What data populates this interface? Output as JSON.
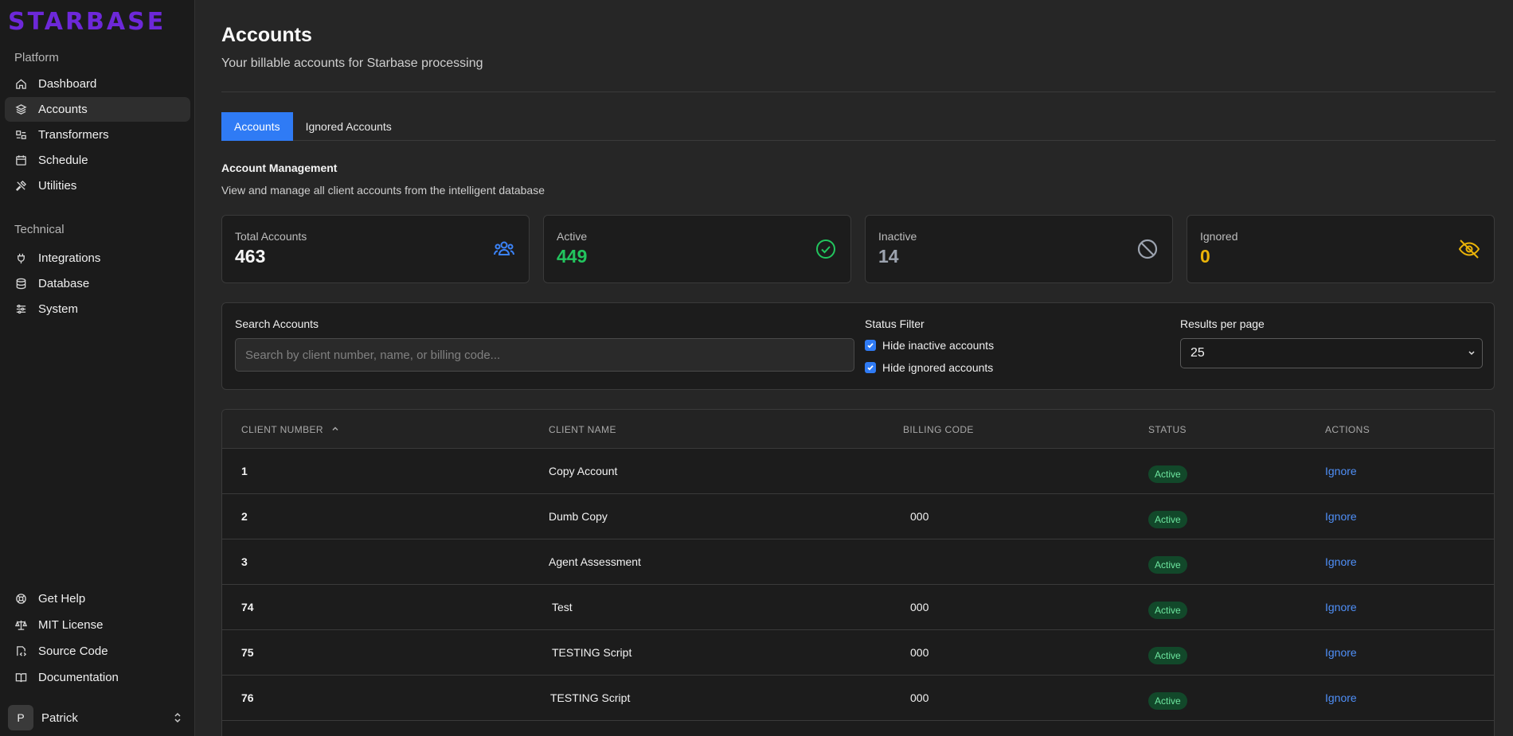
{
  "brand": {
    "logo_text": "STARBASE",
    "accent": "#6d28d9"
  },
  "sidebar": {
    "platform_heading": "Platform",
    "platform_items": [
      {
        "label": "Dashboard",
        "icon": "home-icon"
      },
      {
        "label": "Accounts",
        "icon": "layers-icon",
        "active": true
      },
      {
        "label": "Transformers",
        "icon": "transform-icon"
      },
      {
        "label": "Schedule",
        "icon": "calendar-icon"
      },
      {
        "label": "Utilities",
        "icon": "tools-icon"
      }
    ],
    "technical_heading": "Technical",
    "technical_items": [
      {
        "label": "Integrations",
        "icon": "plug-icon"
      },
      {
        "label": "Database",
        "icon": "database-icon"
      },
      {
        "label": "System",
        "icon": "sliders-icon"
      }
    ],
    "footer_items": [
      {
        "label": "Get Help",
        "icon": "lifebuoy-icon"
      },
      {
        "label": "MIT License",
        "icon": "scale-icon"
      },
      {
        "label": "Source Code",
        "icon": "code-file-icon"
      },
      {
        "label": "Documentation",
        "icon": "book-icon"
      }
    ],
    "user": {
      "initial": "P",
      "name": "Patrick"
    }
  },
  "header": {
    "title": "Accounts",
    "subtitle": "Your billable accounts for Starbase processing"
  },
  "tabs": [
    {
      "label": "Accounts",
      "active": true
    },
    {
      "label": "Ignored Accounts",
      "active": false
    }
  ],
  "management": {
    "title": "Account Management",
    "description": "View and manage all client accounts from the intelligent database"
  },
  "stats": [
    {
      "label": "Total Accounts",
      "value": "463",
      "color": "#f5f5f5",
      "icon": "users-icon",
      "icon_color": "#3b82f6"
    },
    {
      "label": "Active",
      "value": "449",
      "color": "#22c55e",
      "icon": "check-circle-icon",
      "icon_color": "#22c55e"
    },
    {
      "label": "Inactive",
      "value": "14",
      "color": "#9ca3af",
      "icon": "ban-icon",
      "icon_color": "#9ca3af"
    },
    {
      "label": "Ignored",
      "value": "0",
      "color": "#eab308",
      "icon": "eye-off-icon",
      "icon_color": "#eab308"
    }
  ],
  "filters": {
    "search_label": "Search Accounts",
    "search_placeholder": "Search by client number, name, or billing code...",
    "search_value": "",
    "status_label": "Status Filter",
    "hide_inactive_label": "Hide inactive accounts",
    "hide_inactive_checked": true,
    "hide_ignored_label": "Hide ignored accounts",
    "hide_ignored_checked": true,
    "per_page_label": "Results per page",
    "per_page_value": "25"
  },
  "table": {
    "headers": {
      "client_number": "CLIENT NUMBER",
      "client_name": "CLIENT NAME",
      "billing_code": "BILLING CODE",
      "status": "STATUS",
      "actions": "ACTIONS"
    },
    "sort_indicator": "^",
    "rows": [
      {
        "number": "1",
        "name": "Copy Account",
        "billing": "",
        "status": "Active",
        "action": "Ignore"
      },
      {
        "number": "2",
        "name": "Dumb Copy",
        "billing": "000",
        "status": "Active",
        "action": "Ignore"
      },
      {
        "number": "3",
        "name": "Agent Assessment",
        "billing": "",
        "status": "Active",
        "action": "Ignore"
      },
      {
        "number": "74",
        "name": " Test",
        "billing": "000",
        "status": "Active",
        "action": "Ignore"
      },
      {
        "number": "75",
        "name": " TESTING Script",
        "billing": "000",
        "status": "Active",
        "action": "Ignore"
      },
      {
        "number": "76",
        "name": "TESTING Script",
        "billing": "000",
        "status": "Active",
        "action": "Ignore"
      }
    ]
  }
}
